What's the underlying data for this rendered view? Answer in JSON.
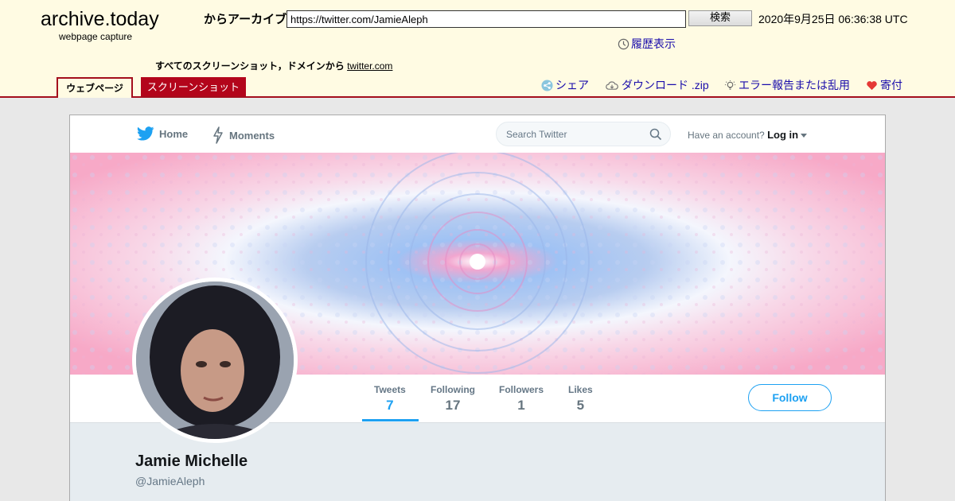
{
  "archive": {
    "logo": "archive.today",
    "logo_sub": "webpage capture",
    "archive_label": "からアーカイブ",
    "url_value": "https://twitter.com/JamieAleph",
    "search_button": "検索",
    "timestamp": "2020年9月25日 06:36:38 UTC",
    "history": "履歴表示",
    "all_screenshots_prefix": "すべてのスクリーンショット，ドメインから",
    "domain_link": "twitter.com",
    "tabs": [
      "ウェブページ",
      "スクリーンショット"
    ],
    "share": "シェア",
    "download": "ダウンロード .zip",
    "report": "エラー報告または乱用",
    "donate": "寄付"
  },
  "twitter": {
    "nav_home": "Home",
    "nav_moments": "Moments",
    "search_placeholder": "Search Twitter",
    "have_account": "Have an account?",
    "login": "Log in",
    "stats": [
      {
        "label": "Tweets",
        "value": "7"
      },
      {
        "label": "Following",
        "value": "17"
      },
      {
        "label": "Followers",
        "value": "1"
      },
      {
        "label": "Likes",
        "value": "5"
      }
    ],
    "follow_button": "Follow",
    "name": "Jamie Michelle",
    "handle": "@JamieAleph"
  },
  "colors": {
    "archive_bg": "#fffbe3",
    "archive_accent": "#a40e1d",
    "twitter_blue": "#1da1f2"
  }
}
